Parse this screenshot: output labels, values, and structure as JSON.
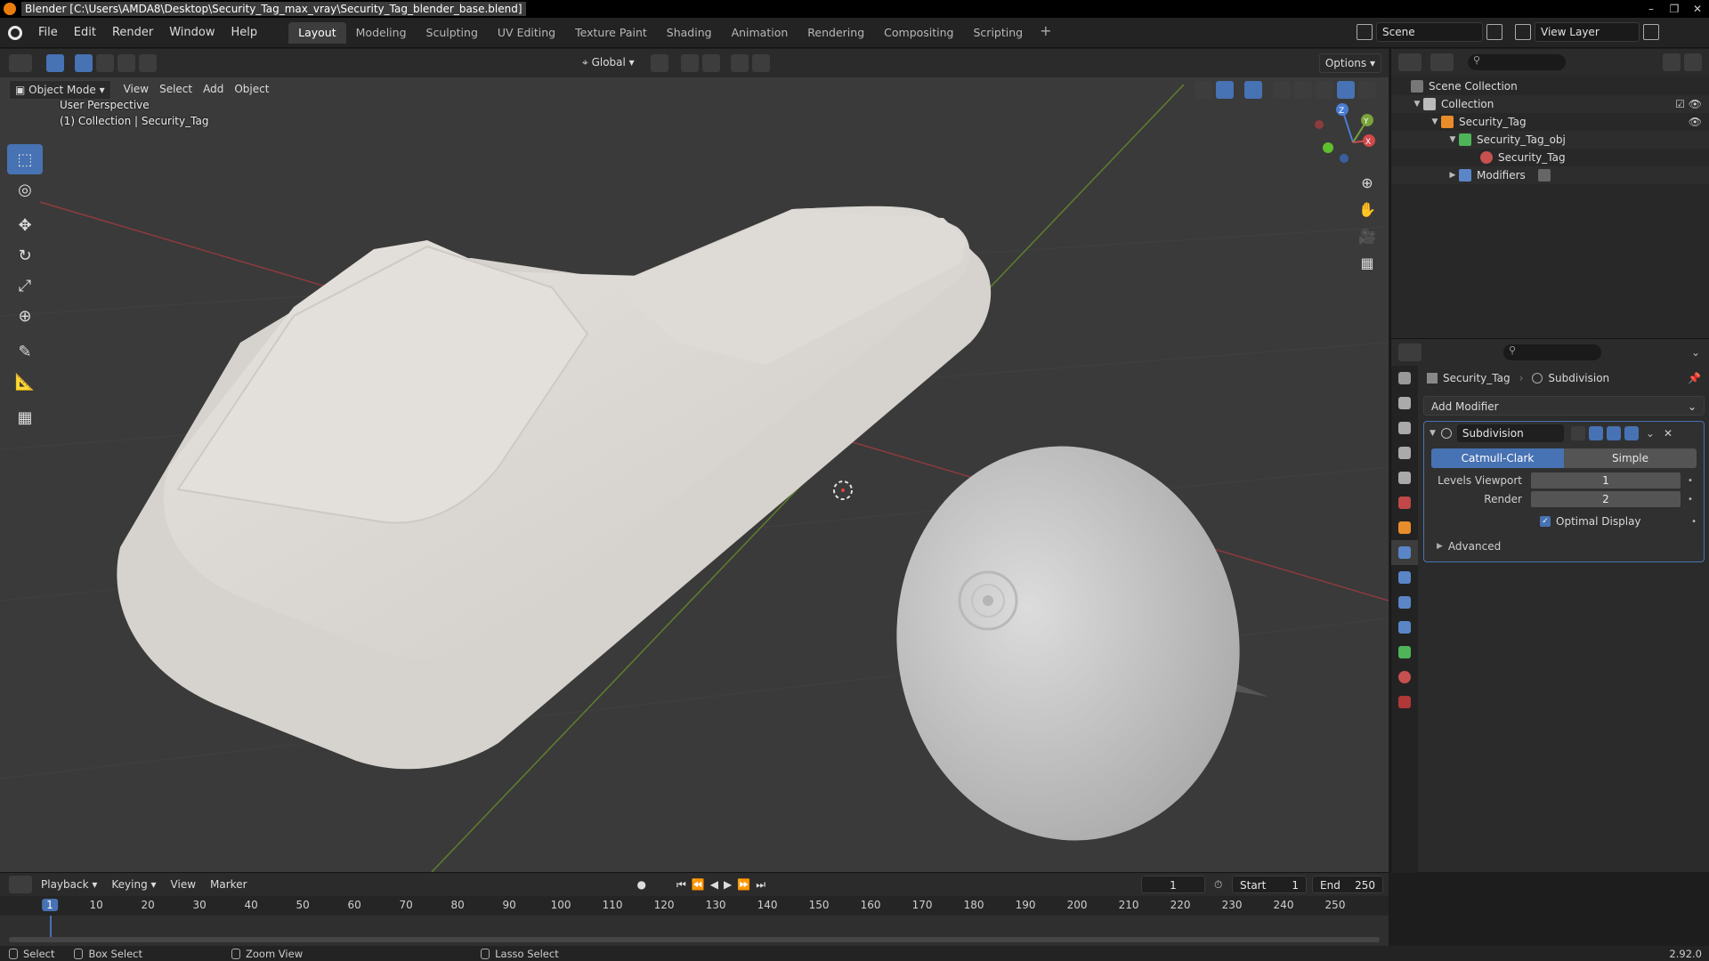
{
  "window": {
    "title": "Blender [C:\\Users\\AMDA8\\Desktop\\Security_Tag_max_vray\\Security_Tag_blender_base.blend]"
  },
  "menu": [
    "File",
    "Edit",
    "Render",
    "Window",
    "Help"
  ],
  "workspaces": [
    "Layout",
    "Modeling",
    "Sculpting",
    "UV Editing",
    "Texture Paint",
    "Shading",
    "Animation",
    "Rendering",
    "Compositing",
    "Scripting"
  ],
  "workspace_active": "Layout",
  "scene": {
    "name": "Scene",
    "view_layer": "View Layer"
  },
  "viewport": {
    "mode": "Object Mode",
    "menus": [
      "View",
      "Select",
      "Add",
      "Object"
    ],
    "transform": "Global",
    "options": "Options",
    "info_line1": "User Perspective",
    "info_line2": "(1) Collection | Security_Tag",
    "gizmo": {
      "x": "X",
      "y": "Y",
      "z": "Z"
    }
  },
  "outliner": {
    "items": [
      {
        "label": "Scene Collection",
        "depth": 0
      },
      {
        "label": "Collection",
        "depth": 1
      },
      {
        "label": "Security_Tag",
        "depth": 2
      },
      {
        "label": "Security_Tag_obj",
        "depth": 3
      },
      {
        "label": "Security_Tag",
        "depth": 4
      },
      {
        "label": "Modifiers",
        "depth": 3
      }
    ]
  },
  "properties": {
    "object": "Security_Tag",
    "modifier_context": "Subdivision",
    "add_modifier": "Add Modifier",
    "modifier": {
      "name": "Subdivision",
      "mode_a": "Catmull-Clark",
      "mode_b": "Simple",
      "levels_viewport_label": "Levels Viewport",
      "levels_viewport": "1",
      "render_label": "Render",
      "render": "2",
      "optimal_display": "Optimal Display",
      "advanced": "Advanced"
    }
  },
  "timeline": {
    "menus": [
      "Playback",
      "Keying",
      "View",
      "Marker"
    ],
    "current_frame": "1",
    "start_label": "Start",
    "start": "1",
    "end_label": "End",
    "end": "250",
    "frame_ticks": [
      "1",
      "10",
      "20",
      "30",
      "40",
      "50",
      "60",
      "70",
      "80",
      "90",
      "100",
      "110",
      "120",
      "130",
      "140",
      "150",
      "160",
      "170",
      "180",
      "190",
      "200",
      "210",
      "220",
      "230",
      "240",
      "250"
    ]
  },
  "statusbar": {
    "select": "Select",
    "box_select": "Box Select",
    "zoom_view": "Zoom View",
    "lasso_select": "Lasso Select",
    "version": "2.92.0"
  },
  "colors": {
    "accent": "#4772b3",
    "viewport_bg": "#3a3a3a",
    "axis_x": "#d0484a",
    "axis_y": "#7aa33a"
  }
}
